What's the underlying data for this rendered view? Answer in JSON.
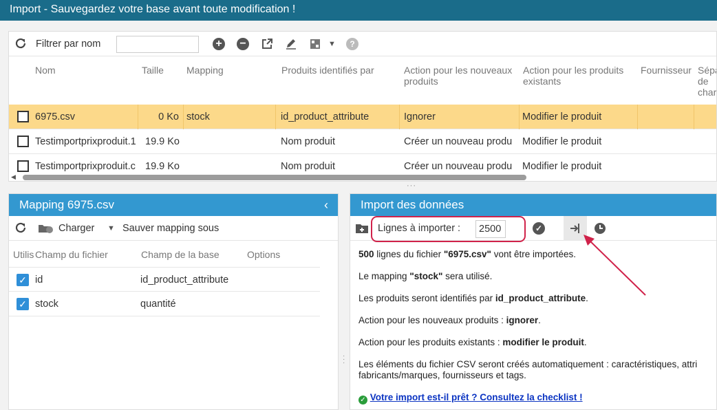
{
  "app": {
    "title": "Import - Sauvegardez votre base avant toute modification !"
  },
  "grid": {
    "filter_label": "Filtrer par nom",
    "filter_value": "",
    "columns": [
      "Nom",
      "Taille",
      "Mapping",
      "Produits identifiés par",
      "Action pour les nouveaux produits",
      "Action pour les produits existants",
      "Fournisseur",
      "Sépa de char"
    ],
    "rows": [
      {
        "name": "6975.csv",
        "size": "0 Ko",
        "mapping": "stock",
        "identified_by": "id_product_attribute",
        "new_action": "Ignorer",
        "existing_action": "Modifier le produit",
        "selected": true
      },
      {
        "name": "Testimportprixproduit.1",
        "size": "19.9 Ko",
        "mapping": "",
        "identified_by": "Nom produit",
        "new_action": "Créer un nouveau produ",
        "existing_action": "Modifier le produit",
        "selected": false
      },
      {
        "name": "Testimportprixproduit.c",
        "size": "19.9 Ko",
        "mapping": "",
        "identified_by": "Nom produit",
        "new_action": "Créer un nouveau produ",
        "existing_action": "Modifier le produit",
        "selected": false
      }
    ]
  },
  "mapping": {
    "title": "Mapping 6975.csv",
    "load_label": "Charger",
    "save_label": "Sauver mapping sous",
    "columns": [
      "Utilis",
      "Champ du fichier",
      "Champ de la base",
      "Options"
    ],
    "rows": [
      {
        "file_field": "id",
        "db_field": "id_product_attribute",
        "checked": true
      },
      {
        "file_field": "stock",
        "db_field": "quantité",
        "checked": true
      }
    ]
  },
  "import": {
    "title": "Import des données",
    "lines_label": "Lignes à importer :",
    "lines_value": "2500",
    "msg1": {
      "count": "500",
      "text1": " lignes du fichier ",
      "file": "\"6975.csv\"",
      "text2": " vont être importées."
    },
    "msg2": {
      "text1": "Le mapping ",
      "mapping": "\"stock\"",
      "text2": " sera utilisé."
    },
    "msg3": {
      "text1": "Les produits seront identifiés par ",
      "key": "id_product_attribute",
      "text2": "."
    },
    "msg4": {
      "text1": "Action pour les nouveaux produits : ",
      "value": "ignorer",
      "text2": "."
    },
    "msg5": {
      "text1": "Action pour les produits existants : ",
      "value": "modifier le produit",
      "text2": "."
    },
    "msg6_line1": "Les éléments du fichier CSV seront créés automatiquement : caractéristiques, attri",
    "msg6_line2": "fabricants/marques, fournisseurs et tags.",
    "checklist_link": "Votre import est-il prêt ? Consultez la checklist !"
  },
  "colors": {
    "topbar": "#1a6c8a",
    "panel_header": "#3398d0",
    "selected_row": "#fcd98a",
    "highlight": "#d0224a"
  }
}
